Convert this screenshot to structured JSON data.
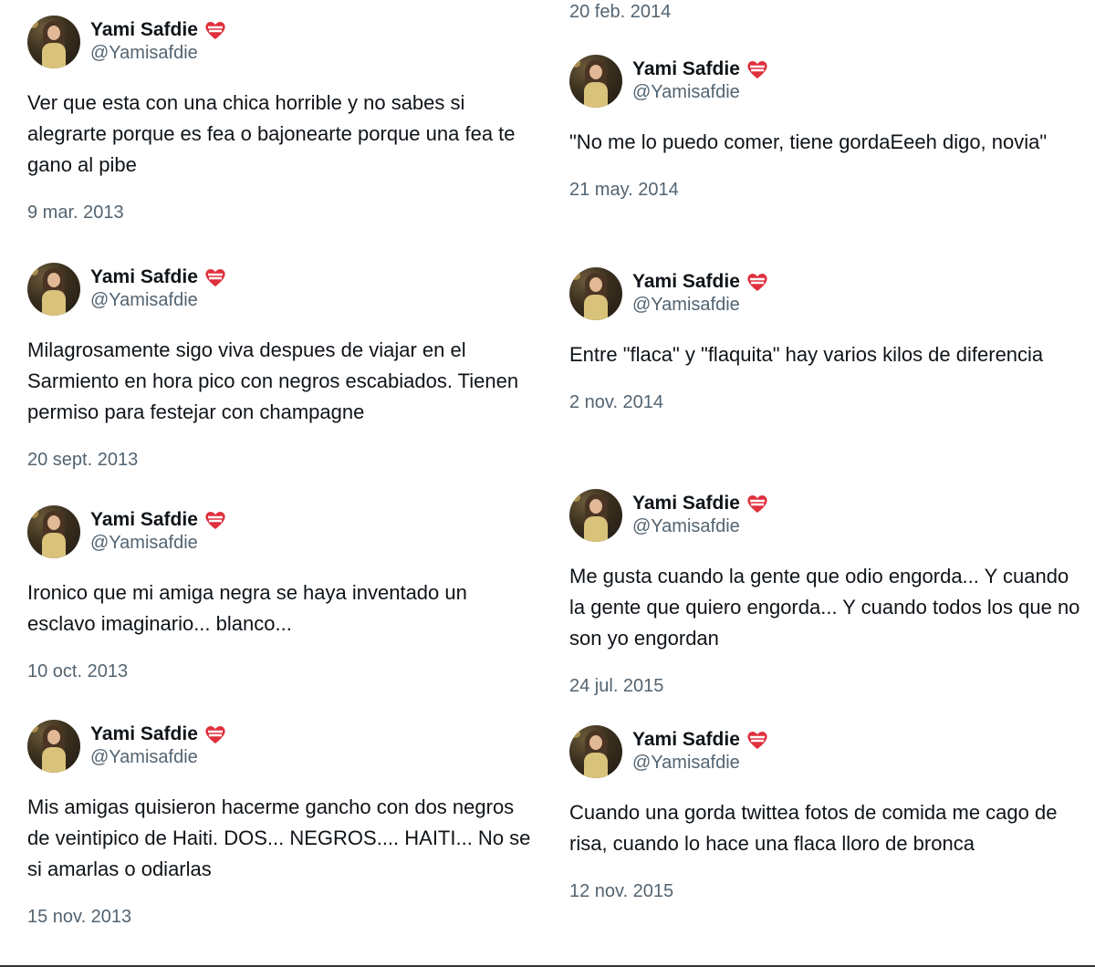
{
  "tweets_left": [
    {
      "name": "Yami Safdie",
      "handle": "@Yamisafdie",
      "text": "Ver que esta con una chica horrible y no sabes si alegrarte porque es fea o bajonearte porque una fea te gano al pibe",
      "date": "9 mar. 2013"
    },
    {
      "name": "Yami Safdie",
      "handle": "@Yamisafdie",
      "text": "Milagrosamente sigo viva despues de viajar en el Sarmiento en hora pico con negros escabiados. Tienen permiso para festejar con champagne",
      "date": "20 sept. 2013"
    },
    {
      "name": "Yami Safdie",
      "handle": "@Yamisafdie",
      "text": "Ironico que mi amiga negra se haya inventado un esclavo imaginario... blanco...",
      "date": "10 oct. 2013"
    },
    {
      "name": "Yami Safdie",
      "handle": "@Yamisafdie",
      "text": "Mis amigas quisieron hacerme gancho con dos negros de veintipico de Haiti. DOS... NEGROS.... HAITI... No se si amarlas o odiarlas",
      "date": "15 nov. 2013"
    }
  ],
  "top_right_date": "20 feb. 2014",
  "tweets_right": [
    {
      "name": "Yami Safdie",
      "handle": "@Yamisafdie",
      "text": "\"No me lo puedo comer, tiene gordaEeeh digo, novia\"",
      "date": "21 may. 2014"
    },
    {
      "name": "Yami Safdie",
      "handle": "@Yamisafdie",
      "text": "Entre \"flaca\" y \"flaquita\" hay varios kilos de diferencia",
      "date": "2 nov. 2014"
    },
    {
      "name": "Yami Safdie",
      "handle": "@Yamisafdie",
      "text": "Me gusta cuando la gente que odio engorda... Y cuando la gente que quiero engorda... Y cuando todos los que no son yo engordan",
      "date": "24 jul. 2015"
    },
    {
      "name": "Yami Safdie",
      "handle": "@Yamisafdie",
      "text": "Cuando una gorda twittea fotos de comida me cago de risa, cuando lo hace una flaca lloro de bronca",
      "date": "12 nov. 2015"
    }
  ],
  "icons": {
    "badge": "argentina-flag-heart-icon",
    "avatar": "profile-photo"
  },
  "colors": {
    "text_primary": "#0f1419",
    "text_secondary": "#536471",
    "badge_red": "#e0303d",
    "badge_white": "#ffffff"
  }
}
